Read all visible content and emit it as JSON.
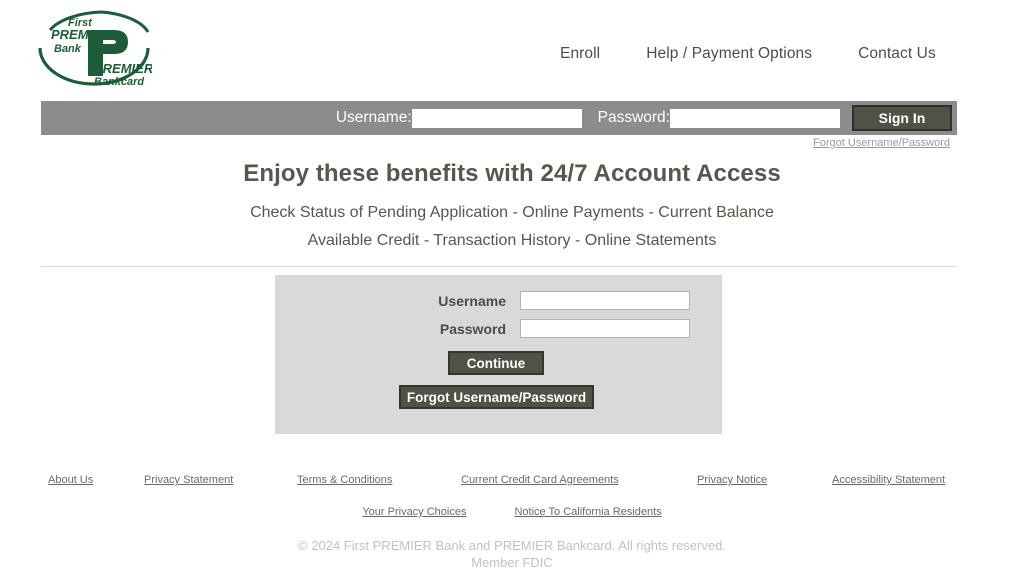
{
  "header": {
    "logo": {
      "icon": "premier-bankcard-logo",
      "line1": "First",
      "line2": "PREMIER",
      "line3": "Bank",
      "line4": "PREMIER",
      "line5": "Bankcard",
      "color": "#1d5c38"
    },
    "nav": [
      {
        "label": "Enroll"
      },
      {
        "label": "Help / Payment Options"
      },
      {
        "label": "Contact Us"
      }
    ]
  },
  "signin_bar": {
    "background": "#8c8c8c",
    "username_label": "Username:",
    "username_value": "",
    "password_label": "Password:",
    "password_value": "",
    "signin_button": "Sign In",
    "forgot_link": "Forgot Username/Password"
  },
  "hero": {
    "title": "Enjoy these benefits with 24/7 Account Access",
    "line1": "Check Status of Pending Application - Online Payments - Current Balance",
    "line2": "Available Credit - Transaction History - Online Statements"
  },
  "login_panel": {
    "background": "#d9d9d9",
    "username_label": "Username",
    "username_value": "",
    "password_label": "Password",
    "password_value": "",
    "continue_button": "Continue",
    "forgot_button": "Forgot Username/Password",
    "button_color": "#4f5345"
  },
  "footer": {
    "row1": [
      {
        "label": "About Us"
      },
      {
        "label": "Privacy Statement"
      },
      {
        "label": "Terms & Conditions"
      },
      {
        "label": "Current Credit Card Agreements"
      },
      {
        "label": "Privacy Notice"
      },
      {
        "label": "Accessibility Statement"
      }
    ],
    "row2": [
      {
        "label": "Your Privacy Choices"
      },
      {
        "label": "Notice To California Residents"
      }
    ],
    "copyright_line1": "© 2024 First PREMIER Bank and PREMIER Bankcard. All rights reserved.",
    "copyright_line2": "Member FDIC"
  }
}
